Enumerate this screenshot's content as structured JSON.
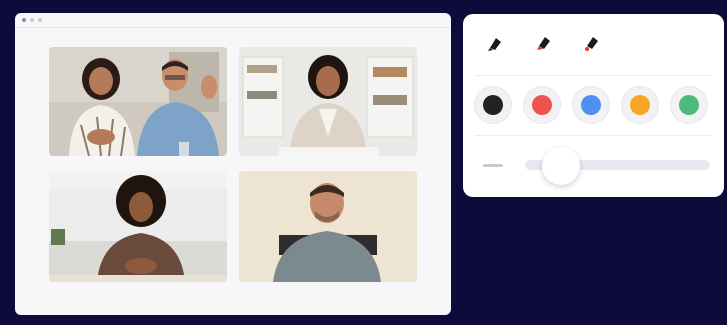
{
  "window": {
    "controls": [
      "close",
      "minimize",
      "maximize"
    ]
  },
  "participants": [
    {
      "id": "tile-1",
      "description_icon": "two-people-video-icon"
    },
    {
      "id": "tile-2",
      "description_icon": "person-video-icon"
    },
    {
      "id": "tile-3",
      "description_icon": "person-video-icon"
    },
    {
      "id": "tile-4",
      "description_icon": "person-video-icon"
    }
  ],
  "toolbar": {
    "tools": [
      {
        "name": "marker-black",
        "color": "#1a1a1a"
      },
      {
        "name": "marker-red",
        "color": "#e53935"
      },
      {
        "name": "eraser-red",
        "color": "#e53935"
      }
    ],
    "colors": [
      {
        "name": "black",
        "hex": "#222222"
      },
      {
        "name": "red",
        "hex": "#ef5350"
      },
      {
        "name": "blue",
        "hex": "#4f8ff1"
      },
      {
        "name": "orange",
        "hex": "#f5a623"
      },
      {
        "name": "green",
        "hex": "#4cbb7a"
      }
    ],
    "brush_size_level": 0.2
  }
}
